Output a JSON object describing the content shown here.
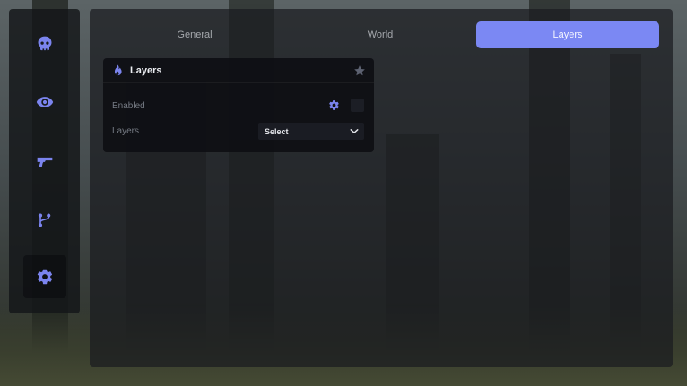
{
  "tabs": [
    {
      "label": "General",
      "active": false
    },
    {
      "label": "World",
      "active": false
    },
    {
      "label": "Layers",
      "active": true
    }
  ],
  "sidebar": {
    "items": [
      {
        "icon": "skull-icon",
        "active": false
      },
      {
        "icon": "eye-icon",
        "active": false
      },
      {
        "icon": "gun-icon",
        "active": false
      },
      {
        "icon": "branch-icon",
        "active": false
      },
      {
        "icon": "gear-icon",
        "active": true
      }
    ]
  },
  "card": {
    "icon": "flame-icon",
    "title": "Layers",
    "enabled_label": "Enabled",
    "enabled_checked": false,
    "layers_label": "Layers",
    "layers_select_value": "Select"
  },
  "colors": {
    "accent": "#7b88f3",
    "icon": "#7b84ee",
    "panel_bg": "#1a1c20",
    "card_bg": "#0e0f14"
  }
}
